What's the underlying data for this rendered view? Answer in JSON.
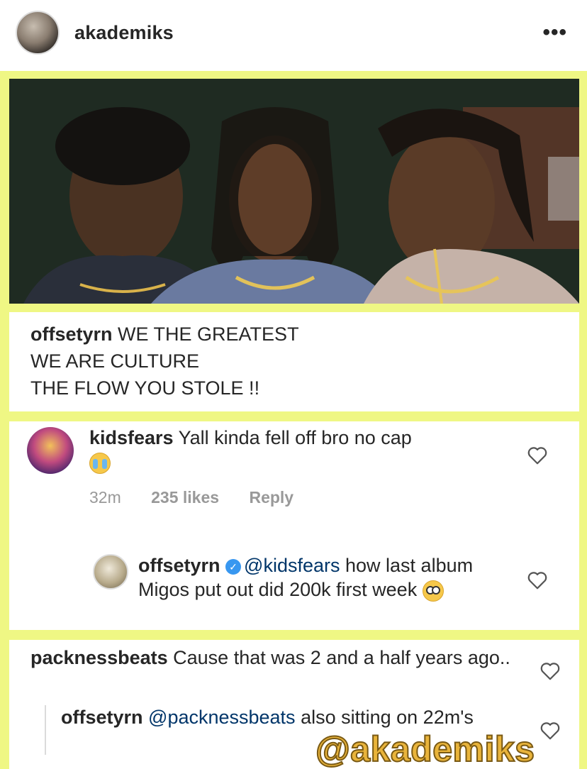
{
  "header": {
    "username": "akademiks",
    "more_icon": "more-horizontal-icon",
    "more_glyph": "•••"
  },
  "post": {
    "caption": {
      "username": "offsetyrn",
      "lines": [
        "WE THE GREATEST",
        "WE ARE CULTURE",
        "THE FLOW YOU STOLE !!"
      ]
    }
  },
  "comments": [
    {
      "username": "kidsfears",
      "text": "Yall kinda fell off bro no cap",
      "emoji": "loudly-crying-face",
      "time": "32m",
      "likes": "235 likes",
      "reply_label": "Reply",
      "reply": {
        "username": "offsetyrn",
        "verified": true,
        "mention": "@kidsfears",
        "text": "how last album Migos put out did 200k first week",
        "emoji": "flushed-face"
      }
    },
    {
      "username": "packnessbeats",
      "text": "Cause that was 2 and a half years ago..",
      "reply": {
        "username": "offsetyrn",
        "mention": "@packnessbeats",
        "text": "also sitting on 22m's"
      }
    }
  ],
  "watermark": "@akademiks",
  "colors": {
    "background": "#eff784",
    "verified": "#3897f0",
    "watermark": "#e9b43b"
  }
}
